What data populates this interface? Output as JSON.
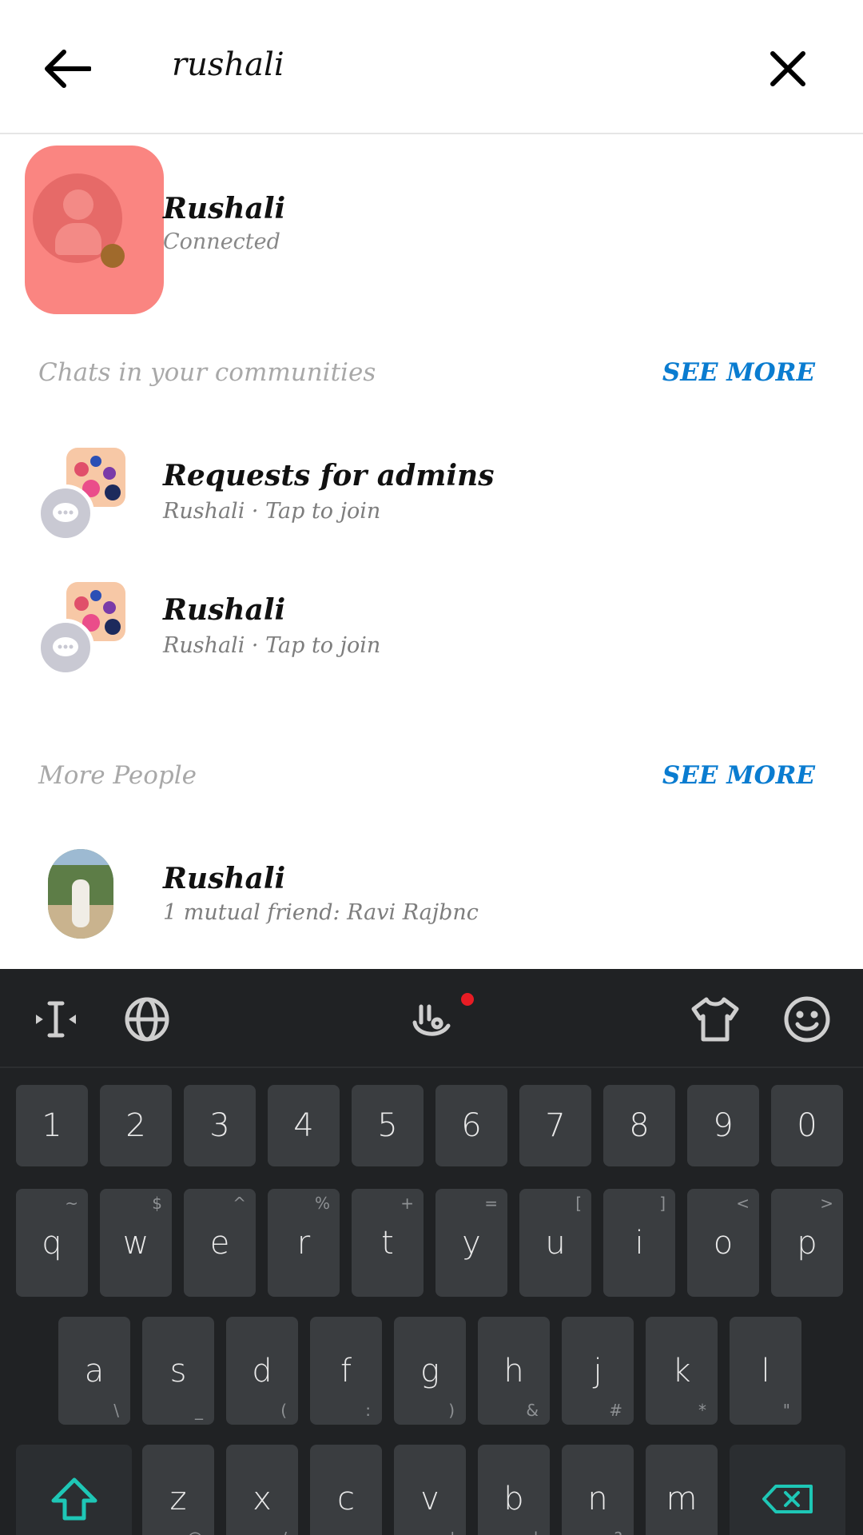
{
  "header": {
    "search_value": "rushali",
    "back_icon": "arrow-left-icon",
    "close_icon": "close-icon"
  },
  "top_result": {
    "name": "Rushali",
    "status": "Connected"
  },
  "communities": {
    "title": "Chats in your communities",
    "see_more": "SEE MORE",
    "items": [
      {
        "title": "Requests for admins",
        "subtitle": "Rushali · Tap to join"
      },
      {
        "title": "Rushali",
        "subtitle": "Rushali · Tap to join"
      }
    ]
  },
  "more_people": {
    "title": "More People",
    "see_more": "SEE MORE",
    "items": [
      {
        "name": "Rushali",
        "subtitle": "1 mutual friend: Ravi Rajbnc"
      }
    ]
  },
  "keyboard": {
    "toolbar": [
      "cursor-icon",
      "globe-icon",
      "gesture-icon",
      "theme-shirt-icon",
      "emoji-icon"
    ],
    "number_row": [
      "1",
      "2",
      "3",
      "4",
      "5",
      "6",
      "7",
      "8",
      "9",
      "0"
    ],
    "row1": [
      {
        "k": "q",
        "h": "~"
      },
      {
        "k": "w",
        "h": "$"
      },
      {
        "k": "e",
        "h": "^"
      },
      {
        "k": "r",
        "h": "%"
      },
      {
        "k": "t",
        "h": "+"
      },
      {
        "k": "y",
        "h": "="
      },
      {
        "k": "u",
        "h": "["
      },
      {
        "k": "i",
        "h": "]"
      },
      {
        "k": "o",
        "h": "<"
      },
      {
        "k": "p",
        "h": ">"
      }
    ],
    "row2": [
      {
        "k": "a",
        "h": "\\"
      },
      {
        "k": "s",
        "h": "_"
      },
      {
        "k": "d",
        "h": "("
      },
      {
        "k": "f",
        "h": ":"
      },
      {
        "k": "g",
        "h": ")"
      },
      {
        "k": "h",
        "h": "&"
      },
      {
        "k": "j",
        "h": "#"
      },
      {
        "k": "k",
        "h": "*"
      },
      {
        "k": "l",
        "h": "\""
      }
    ],
    "row3": [
      {
        "k": "z",
        "h": "@"
      },
      {
        "k": "x",
        "h": "/"
      },
      {
        "k": "c",
        "h": "-"
      },
      {
        "k": "v",
        "h": "'"
      },
      {
        "k": "b",
        "h": "|"
      },
      {
        "k": "n",
        "h": "?"
      },
      {
        "k": "m",
        "h": "."
      }
    ],
    "accent_color": "#1ec7b6"
  }
}
